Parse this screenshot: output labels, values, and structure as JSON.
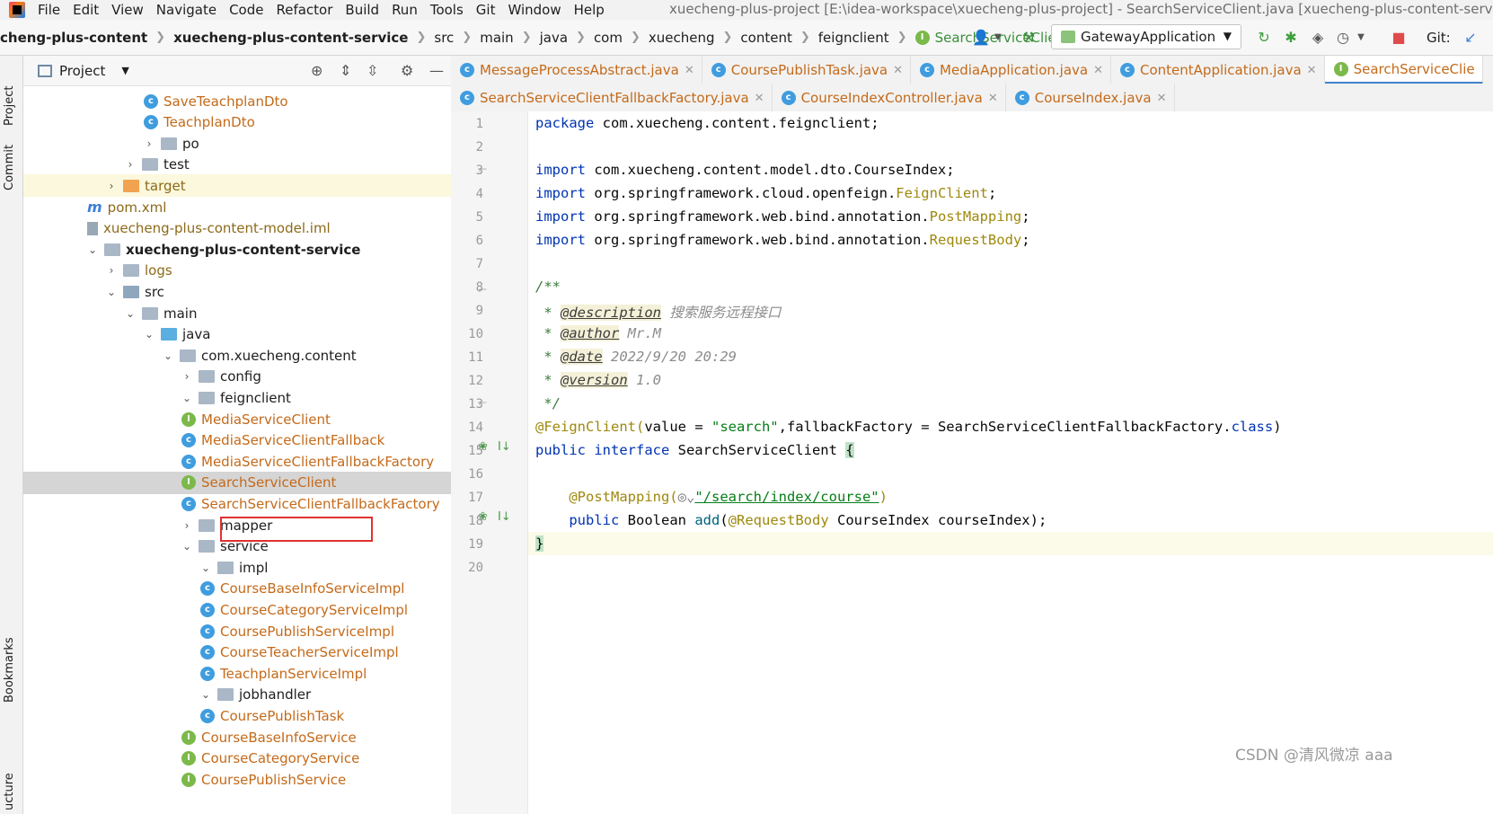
{
  "menu": [
    "File",
    "Edit",
    "View",
    "Navigate",
    "Code",
    "Refactor",
    "Build",
    "Run",
    "Tools",
    "Git",
    "Window",
    "Help"
  ],
  "window_title": "xuecheng-plus-project [E:\\idea-workspace\\xuecheng-plus-project] - SearchServiceClient.java [xuecheng-plus-content-service]",
  "breadcrumb": [
    "cheng-plus-content",
    "xuecheng-plus-content-service",
    "src",
    "main",
    "java",
    "com",
    "xuecheng",
    "content",
    "feignclient",
    "SearchServiceClient"
  ],
  "run_config": "GatewayApplication",
  "git_label": "Git:",
  "project_panel": {
    "title": "Project",
    "rows": [
      {
        "text": "SaveTeachplanDto",
        "indent": 4,
        "icon": "class",
        "style": "orange"
      },
      {
        "text": "TeachplanDto",
        "indent": 4,
        "icon": "class",
        "style": "orange"
      },
      {
        "text": "po",
        "indent": 3,
        "icon": "folder",
        "arrow": "right",
        "style": "normal"
      },
      {
        "text": "test",
        "indent": 2,
        "icon": "folder",
        "arrow": "right",
        "style": "normal"
      },
      {
        "text": "target",
        "indent": 1,
        "icon": "folder-orange",
        "arrow": "right",
        "style": "olive",
        "highlight": true
      },
      {
        "text": "pom.xml",
        "indent": 1,
        "icon": "maven",
        "style": "olive"
      },
      {
        "text": "xuecheng-plus-content-model.iml",
        "indent": 1,
        "icon": "iml",
        "style": "olive"
      },
      {
        "text": "xuecheng-plus-content-service",
        "indent": 0,
        "icon": "folder",
        "arrow": "down",
        "style": "bold"
      },
      {
        "text": "logs",
        "indent": 1,
        "icon": "folder",
        "arrow": "right",
        "style": "olive"
      },
      {
        "text": "src",
        "indent": 1,
        "icon": "folder-src",
        "arrow": "down",
        "style": "normal"
      },
      {
        "text": "main",
        "indent": 2,
        "icon": "folder",
        "arrow": "down",
        "style": "normal"
      },
      {
        "text": "java",
        "indent": 3,
        "icon": "folder-java",
        "arrow": "down",
        "style": "normal"
      },
      {
        "text": "com.xuecheng.content",
        "indent": 4,
        "icon": "folder-pkg",
        "arrow": "down",
        "style": "normal"
      },
      {
        "text": "config",
        "indent": 5,
        "icon": "folder-pkg",
        "arrow": "right",
        "style": "normal"
      },
      {
        "text": "feignclient",
        "indent": 5,
        "icon": "folder-pkg",
        "arrow": "down",
        "style": "normal"
      },
      {
        "text": "MediaServiceClient",
        "indent": 6,
        "icon": "interface",
        "style": "orange"
      },
      {
        "text": "MediaServiceClientFallback",
        "indent": 6,
        "icon": "class",
        "style": "orange"
      },
      {
        "text": "MediaServiceClientFallbackFactory",
        "indent": 6,
        "icon": "class",
        "style": "orange"
      },
      {
        "text": "SearchServiceClient",
        "indent": 6,
        "icon": "interface",
        "style": "orange",
        "selected": true
      },
      {
        "text": "SearchServiceClientFallbackFactory",
        "indent": 6,
        "icon": "class",
        "style": "orange"
      },
      {
        "text": "mapper",
        "indent": 5,
        "icon": "folder-pkg",
        "arrow": "right",
        "style": "normal"
      },
      {
        "text": "service",
        "indent": 5,
        "icon": "folder-pkg",
        "arrow": "down",
        "style": "normal"
      },
      {
        "text": "impl",
        "indent": 6,
        "icon": "folder-pkg",
        "arrow": "down",
        "style": "normal"
      },
      {
        "text": "CourseBaseInfoServiceImpl",
        "indent": 7,
        "icon": "class",
        "style": "orange"
      },
      {
        "text": "CourseCategoryServiceImpl",
        "indent": 7,
        "icon": "class",
        "style": "orange"
      },
      {
        "text": "CoursePublishServiceImpl",
        "indent": 7,
        "icon": "class",
        "style": "orange"
      },
      {
        "text": "CourseTeacherServiceImpl",
        "indent": 7,
        "icon": "class",
        "style": "orange"
      },
      {
        "text": "TeachplanServiceImpl",
        "indent": 7,
        "icon": "class",
        "style": "orange"
      },
      {
        "text": "jobhandler",
        "indent": 6,
        "icon": "folder-pkg",
        "arrow": "down",
        "style": "normal"
      },
      {
        "text": "CoursePublishTask",
        "indent": 7,
        "icon": "class",
        "style": "orange"
      },
      {
        "text": "CourseBaseInfoService",
        "indent": 6,
        "icon": "interface",
        "style": "orange"
      },
      {
        "text": "CourseCategoryService",
        "indent": 6,
        "icon": "interface",
        "style": "orange"
      },
      {
        "text": "CoursePublishService",
        "indent": 6,
        "icon": "interface",
        "style": "orange"
      }
    ]
  },
  "tabs_row1": [
    {
      "label": "MessageProcessAbstract.java",
      "icon": "class"
    },
    {
      "label": "CoursePublishTask.java",
      "icon": "class"
    },
    {
      "label": "MediaApplication.java",
      "icon": "app"
    },
    {
      "label": "ContentApplication.java",
      "icon": "app"
    },
    {
      "label": "SearchServiceClie",
      "icon": "interface",
      "active": true
    }
  ],
  "tabs_row2": [
    {
      "label": "SearchServiceClientFallbackFactory.java",
      "icon": "class"
    },
    {
      "label": "CourseIndexController.java",
      "icon": "class"
    },
    {
      "label": "CourseIndex.java",
      "icon": "class"
    }
  ],
  "line_numbers": [
    "1",
    "2",
    "3",
    "4",
    "5",
    "6",
    "7",
    "8",
    "9",
    "10",
    "11",
    "12",
    "13",
    "14",
    "15",
    "16",
    "17",
    "18",
    "19",
    "20"
  ],
  "code": {
    "l1_kw": "package",
    "l1_rest": " com.xuecheng.content.feignclient;",
    "l3_kw": "import",
    "l3_rest": " com.xuecheng.content.model.dto.CourseIndex;",
    "l4_kw": "import",
    "l4_rest": " org.springframework.cloud.openfeign.",
    "l4_cls": "FeignClient",
    "l4_end": ";",
    "l5_kw": "import",
    "l5_rest": " org.springframework.web.bind.annotation.",
    "l5_cls": "PostMapping",
    "l5_end": ";",
    "l6_kw": "import",
    "l6_rest": " org.springframework.web.bind.annotation.",
    "l6_cls": "RequestBody",
    "l6_end": ";",
    "l8": "/**",
    "l9_star": " * ",
    "l9_tag": "@description",
    "l9_text": " 搜索服务远程接口",
    "l10_star": " * ",
    "l10_tag": "@author",
    "l10_text": " Mr.M",
    "l11_star": " * ",
    "l11_tag": "@date",
    "l11_text": " 2022/9/20 20:29",
    "l12_star": " * ",
    "l12_tag": "@version",
    "l12_text": " 1.0",
    "l13": " */",
    "l14_ann": "@FeignClient(",
    "l14_a": "value = ",
    "l14_str": "\"search\"",
    "l14_b": ",fallbackFactory = SearchServiceClientFallbackFactory.",
    "l14_kw": "class",
    "l14_c": ")",
    "l15_kw": "public interface",
    "l15_rest": " SearchServiceClient ",
    "l15_brace": "{",
    "l17_indent": "    ",
    "l17_ann": "@PostMapping(",
    "l17_str": "\"/search/index/course\"",
    "l17_end": ")",
    "l18_indent": "    ",
    "l18_kw": "public",
    "l18_a": " Boolean ",
    "l18_meth": "add",
    "l18_b": "(",
    "l18_ann": "@RequestBody",
    "l18_c": " CourseIndex courseIndex);",
    "l19_brace": "}"
  },
  "watermark": "CSDN @清风微凉 aaa",
  "left_strip": [
    "Project",
    "Commit",
    "Bookmarks",
    "ucture"
  ]
}
